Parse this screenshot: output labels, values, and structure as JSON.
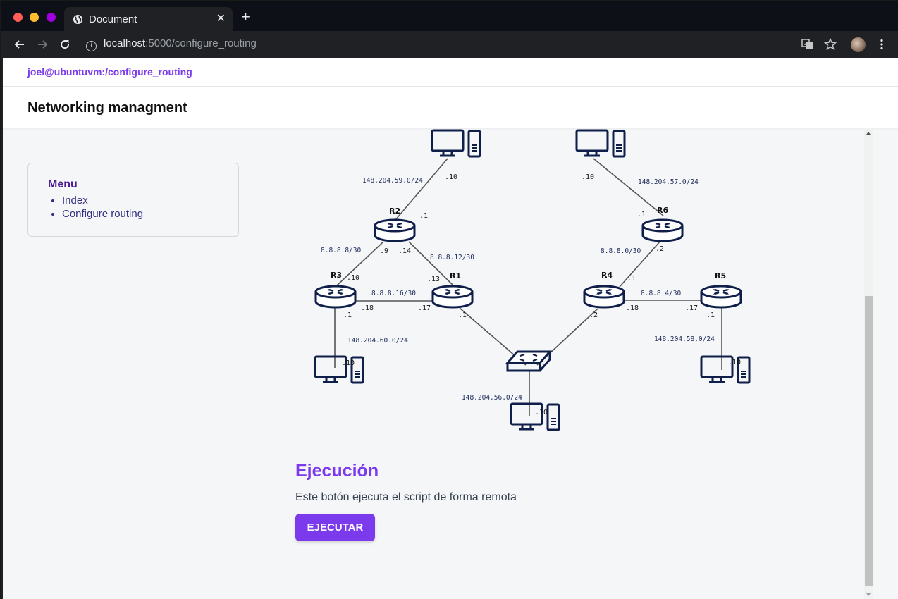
{
  "browser": {
    "tab_title": "Document",
    "tab_close": "✕",
    "new_tab": "+",
    "url_host": "localhost",
    "url_path": ":5000/configure_routing"
  },
  "topbar": {
    "user_path": "joel@ubuntuvm:/configure_routing"
  },
  "header": {
    "title": "Networking managment"
  },
  "menu": {
    "title": "Menu",
    "items": [
      {
        "label": "Index"
      },
      {
        "label": "Configure routing"
      }
    ]
  },
  "diagram": {
    "routers": [
      {
        "name": "R2"
      },
      {
        "name": "R6"
      },
      {
        "name": "R3"
      },
      {
        "name": "R1"
      },
      {
        "name": "R4"
      },
      {
        "name": "R5"
      }
    ],
    "networks": [
      "148.204.59.0/24",
      "148.204.57.0/24",
      "8.8.8.8/30",
      "8.8.8.12/30",
      "8.8.8.0/30",
      "8.8.8.16/30",
      "8.8.8.4/30",
      "148.204.60.0/24",
      "148.204.58.0/24",
      "148.204.56.0/24"
    ],
    "hosts": [
      ".10",
      ".1",
      ".10",
      ".1",
      ".9",
      ".14",
      ".2",
      ".10",
      ".13",
      ".1",
      ".18",
      ".17",
      ".1",
      ".1",
      ".2",
      ".18",
      ".17",
      ".1",
      ".10",
      ".10",
      ".10"
    ]
  },
  "section": {
    "title": "Ejecución",
    "description": "Este botón ejecuta el script de forma remota",
    "button_label": "EJECUTAR"
  },
  "colors": {
    "accent": "#7c3aed",
    "menu_title": "#4c1d95",
    "device": "#0f1f4a"
  }
}
